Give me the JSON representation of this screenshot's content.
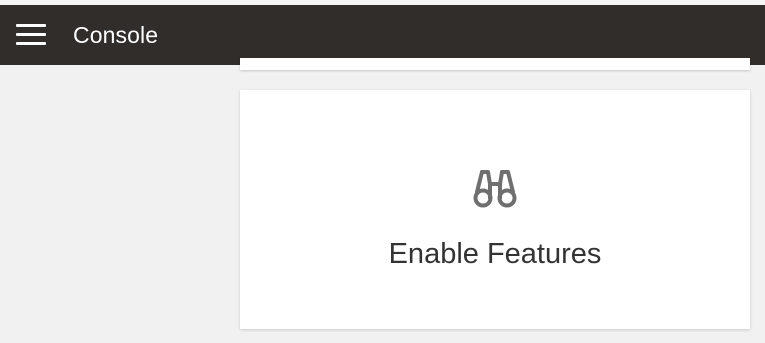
{
  "header": {
    "title": "Console",
    "menu_icon": "hamburger-menu-icon",
    "background_color": "#312d2a"
  },
  "main": {
    "feature_card": {
      "icon": "binoculars-icon",
      "label": "Enable Features"
    }
  }
}
